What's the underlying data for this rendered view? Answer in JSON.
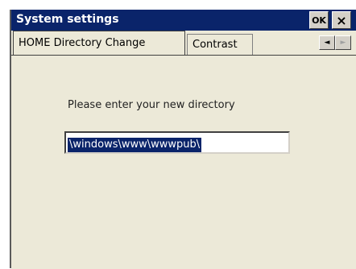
{
  "window": {
    "title": "System settings",
    "ok_label": "OK",
    "close_label": "×"
  },
  "tabs": [
    {
      "label": "HOME Directory Change",
      "active": true
    },
    {
      "label": "Contrast",
      "active": false
    }
  ],
  "tab_scroll": {
    "left": "◄",
    "right": "►"
  },
  "form": {
    "prompt": "Please enter your new directory",
    "directory_value": "\\windows\\www\\wwwpub\\"
  },
  "colors": {
    "titlebar": "#0a246a",
    "selection": "#0a246a",
    "panel": "#ece9d8"
  }
}
